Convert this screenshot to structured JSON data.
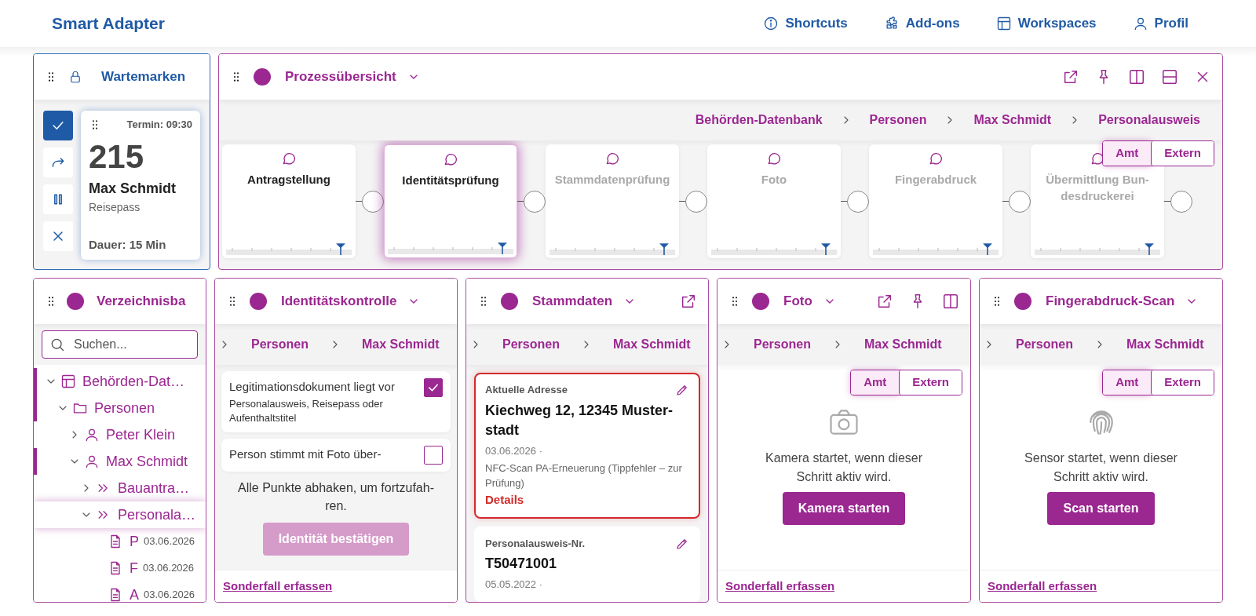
{
  "header": {
    "brand": "Smart Adapter",
    "nav": [
      {
        "label": "Shortcuts"
      },
      {
        "label": "Add-ons"
      },
      {
        "label": "Workspaces"
      },
      {
        "label": "Profil"
      }
    ]
  },
  "queue_panel": {
    "title": "Wartemarken",
    "actions": [
      {
        "selected": true
      },
      {
        "selected": false
      },
      {
        "selected": false
      },
      {
        "selected": false
      }
    ],
    "ticket": {
      "appointment": "Termin: 09:30",
      "number": "215",
      "name": "Max Schmidt",
      "document": "Reisepass",
      "duration": "Dauer: 15 Min"
    }
  },
  "process_panel": {
    "title": "Prozessübersicht",
    "breadcrumb": [
      "Behörden-Datenbank",
      "Personen",
      "Max Schmidt",
      "Personalausweis"
    ],
    "toggle": [
      {
        "label": "Amt",
        "selected": true
      },
      {
        "label": "Extern",
        "selected": false
      }
    ],
    "steps": [
      {
        "label": "Antragstellung",
        "reached": true,
        "selected": false
      },
      {
        "label": "Identitätsprüfung",
        "reached": true,
        "selected": true
      },
      {
        "label": "Stammdatenprüfung",
        "reached": false,
        "selected": false
      },
      {
        "label": "Foto",
        "reached": false,
        "selected": false
      },
      {
        "label": "Fingerabdruck",
        "reached": false,
        "selected": false
      },
      {
        "label": "Übermittlung Bun-desdruckerei",
        "reached": false,
        "selected": false
      }
    ]
  },
  "directory_panel": {
    "title": "Verzeichnisba",
    "search": {
      "placeholder": "Suchen..."
    },
    "tree": [
      {
        "kind": "database",
        "label": "Behörden-Dat…",
        "expanded": true,
        "marked": true,
        "selected": false,
        "children": [
          {
            "kind": "folder",
            "label": "Personen",
            "expanded": true,
            "marked": true,
            "selected": false,
            "children": [
              {
                "kind": "person",
                "label": "Peter Klein",
                "expanded": false,
                "marked": false,
                "selected": false
              },
              {
                "kind": "person",
                "label": "Max Schmidt",
                "expanded": true,
                "marked": true,
                "selected": false,
                "children": [
                  {
                    "kind": "case",
                    "label": "Bauantra…",
                    "expanded": false,
                    "marked": false,
                    "selected": false
                  },
                  {
                    "kind": "case",
                    "label": "Personala…",
                    "expanded": true,
                    "marked": false,
                    "selected": true,
                    "children": [
                      {
                        "kind": "document",
                        "label": "P",
                        "date": "03.06.2026",
                        "marked": false,
                        "selected": false
                      },
                      {
                        "kind": "document",
                        "label": "F",
                        "date": "03.06.2026",
                        "marked": false,
                        "selected": false
                      },
                      {
                        "kind": "document",
                        "label": "A",
                        "date": "03.06.2026",
                        "marked": false,
                        "selected": false
                      }
                    ]
                  }
                ]
              }
            ]
          }
        ]
      }
    ]
  },
  "identity_panel": {
    "title": "Identitätskontrolle",
    "breadcrumb": [
      "Personen",
      "Max Schmidt"
    ],
    "checks": [
      {
        "title": "Legitimationsdokument liegt vor",
        "subtitle": "Personalausweis, Reisepass oder Aufenthaltstitel",
        "checked": true
      },
      {
        "title": "Person stimmt mit Foto über-",
        "checked": false
      }
    ],
    "hint": "Alle Punkte abhaken, um fortzufah-ren.",
    "button": {
      "label": "Identität bestätigen",
      "disabled": true
    },
    "link": "Sonderfall erfassen"
  },
  "master_data_panel": {
    "title": "Stammdaten",
    "breadcrumb": [
      "Personen",
      "Max Schmidt"
    ],
    "fields": [
      {
        "label": "Aktuelle Adresse",
        "value": "Kiechweg 12, 12345 Muster-stadt",
        "date": "03.06.2026 ·",
        "note": "NFC-Scan PA-Erneuerung (Tippfehler – zur Prüfung)",
        "link": "Details",
        "flagged": true
      },
      {
        "label": "Personalausweis-Nr.",
        "value": "T50471001",
        "date": "05.05.2022 ·",
        "flagged": false
      }
    ]
  },
  "capture_panels": [
    {
      "kind": "camera",
      "title": "Foto",
      "breadcrumb": [
        "Personen",
        "Max Schmidt"
      ],
      "toggle": [
        {
          "label": "Amt",
          "selected": true
        },
        {
          "label": "Extern",
          "selected": false
        }
      ],
      "message": "Kamera startet, wenn dieser Schritt aktiv wird.",
      "button": "Kamera starten",
      "link": "Sonderfall erfassen"
    },
    {
      "kind": "fingerprint",
      "title": "Fingerabdruck-Scan",
      "breadcrumb": [
        "Personen",
        "Max Schmidt"
      ],
      "toggle": [
        {
          "label": "Amt",
          "selected": true
        },
        {
          "label": "Extern",
          "selected": false
        }
      ],
      "message": "Sensor startet, wenn dieser Schritt aktiv wird.",
      "button": "Scan starten",
      "link": "Sonderfall erfassen"
    }
  ]
}
